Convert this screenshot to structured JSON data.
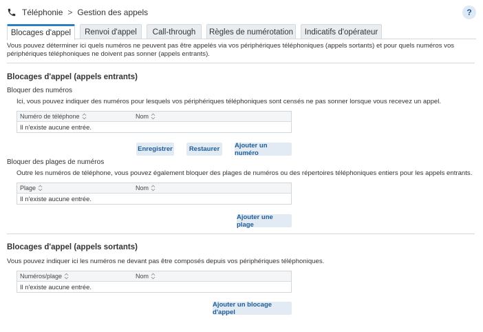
{
  "header": {
    "breadcrumb_root": "Téléphonie",
    "breadcrumb_separator": ">",
    "breadcrumb_current": "Gestion des appels",
    "help_label": "?"
  },
  "tabs": [
    {
      "label": "Blocages d'appel",
      "active": true
    },
    {
      "label": "Renvoi d'appel",
      "active": false
    },
    {
      "label": "Call-through",
      "active": false
    },
    {
      "label": "Règles de numérotation",
      "active": false
    },
    {
      "label": "Indicatifs d'opérateur",
      "active": false
    }
  ],
  "intro": "Vous pouvez déterminer ici quels numéros ne peuvent pas être appelés via vos périphériques téléphoniques (appels sortants) et pour quels numéros vos périphériques téléphoniques ne doivent pas sonner (appels entrants).",
  "incoming": {
    "title": "Blocages d'appel (appels entrants)",
    "numbers": {
      "title": "Bloquer des numéros",
      "description": "Ici, vous pouvez indiquer des numéros pour lesquels vos périphériques téléphoniques sont censés ne pas sonner lorsque vous recevez un appel.",
      "columns": [
        "Numéro de téléphone",
        "Nom"
      ],
      "empty_text": "Il n'existe aucune entrée.",
      "buttons": {
        "save": "Enregistrer",
        "restore": "Restaurer",
        "add": "Ajouter un numéro"
      }
    },
    "ranges": {
      "title": "Bloquer des plages de numéros",
      "description": "Outre les numéros de téléphone, vous pouvez également bloquer des plages de numéros ou des répertoires téléphoniques entiers pour les appels entrants.",
      "columns": [
        "Plage",
        "Nom"
      ],
      "empty_text": "Il n'existe aucune entrée.",
      "add_button": "Ajouter une plage"
    }
  },
  "outgoing": {
    "title": "Blocages d'appel (appels sortants)",
    "description": "Vous pouvez indiquer ici les numéros ne devant pas être composés depuis vos périphériques téléphoniques.",
    "columns": [
      "Numéros/plage",
      "Nom"
    ],
    "empty_text": "Il n'existe aucune entrée.",
    "add_button": "Ajouter un blocage d'appel"
  },
  "colors": {
    "accent": "#2b7ec1",
    "button_bg": "#e2ebf3",
    "button_text": "#1e5c97"
  },
  "icons": {
    "breadcrumb": "phone-icon",
    "sort": "sort-icon"
  }
}
